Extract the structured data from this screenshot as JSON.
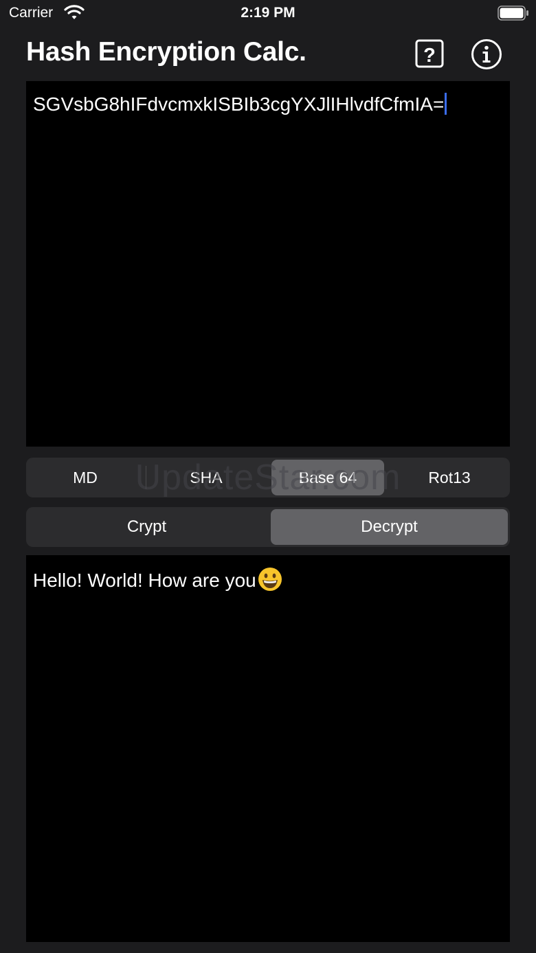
{
  "status": {
    "carrier": "Carrier",
    "time": "2:19 PM"
  },
  "header": {
    "title": "Hash Encryption Calc.",
    "help_icon": "question-mark-box-icon",
    "info_icon": "info-circle-icon"
  },
  "input": {
    "value": "SGVsbG8hIFdvcmxkISBIb3cgYXJlIHlvdfCfmIA="
  },
  "algorithms": {
    "items": [
      "MD",
      "SHA",
      "Base 64",
      "Rot13"
    ],
    "selected": "Base 64"
  },
  "modes": {
    "items": [
      "Crypt",
      "Decrypt"
    ],
    "selected": "Decrypt"
  },
  "output": {
    "value": "Hello! World! How are you",
    "emoji_icon": "grinning-face-icon"
  },
  "watermark": "UpdateStar.com",
  "colors": {
    "background": "#1c1c1e",
    "textbox": "#000000",
    "segment_bg": "#2c2c2e",
    "segment_selected": "#636366",
    "caret": "#3b6df0"
  }
}
